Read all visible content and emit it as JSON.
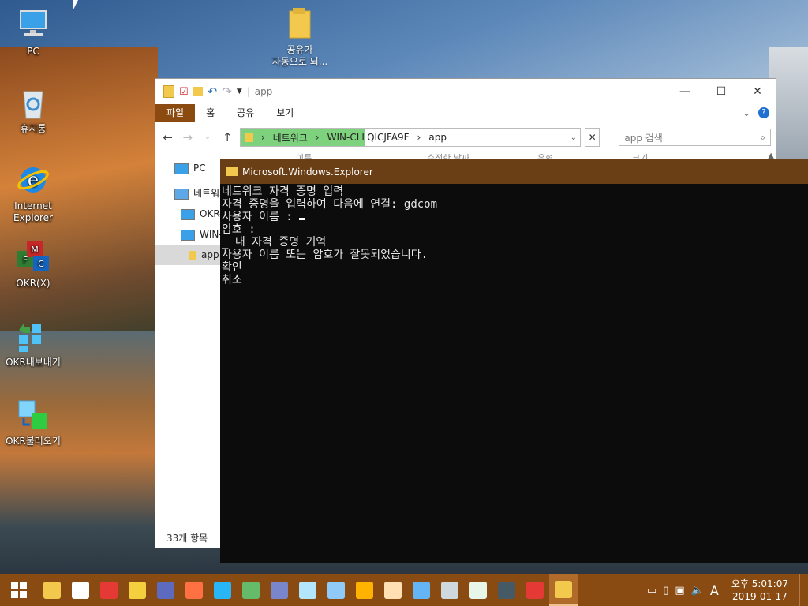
{
  "desktop": {
    "icons": [
      {
        "label": "PC",
        "icon": "pc-icon"
      },
      {
        "label": "휴지통",
        "icon": "recycle-bin-icon"
      },
      {
        "label": "Internet Explorer",
        "icon": "internet-explorer-icon"
      },
      {
        "label": "OKR(X)",
        "icon": "okr-icon"
      },
      {
        "label": "OKR내보내기",
        "icon": "okr-export-icon"
      },
      {
        "label": "OKR불러오기",
        "icon": "okr-import-icon"
      }
    ],
    "folder": {
      "label_line1": "공유가",
      "label_line2": "자동으로 되..."
    }
  },
  "explorer": {
    "title": "app",
    "ribbon_tabs": [
      "파일",
      "홈",
      "공유",
      "보기"
    ],
    "breadcrumb": [
      "네트워크",
      "WIN-CLLQICJFA9F",
      "app"
    ],
    "search_placeholder": "app 검색",
    "columns": [
      "이름",
      "수정한 날짜",
      "유형",
      "크기"
    ],
    "nav": [
      {
        "label": "PC"
      },
      {
        "label": "네트워크"
      },
      {
        "label": "OKR-"
      },
      {
        "label": "WIN-"
      },
      {
        "label": "app"
      }
    ],
    "status": "33개 항목"
  },
  "console": {
    "title": "Microsoft.Windows.Explorer",
    "lines": [
      "네트워크 자격 증명 입력",
      "자격 증명을 입력하여 다음에 연결: gdcom",
      "사용자 이름 : ",
      "암호 :",
      "_ 내 자격 증명 기억",
      "사용자 이름 또는 암호가 잘못되었습니다.",
      "확인",
      "취소"
    ]
  },
  "taskbar": {
    "apps": [
      "file-explorer-icon",
      "capture-icon",
      "anydesk-icon",
      "player-icon",
      "browser-icon",
      "ccleaner-icon",
      "butterfly-icon",
      "globe-icon",
      "remote-icon",
      "document-icon",
      "network-icon",
      "cleaner-icon",
      "archive-icon",
      "laptop-icon",
      "tools-icon",
      "terminal-icon",
      "screenshot-icon",
      "close-app-icon",
      "folder-app-icon"
    ],
    "tray_ime": "A",
    "clock_time": "오후 5:01:07",
    "clock_date": "2019-01-17"
  },
  "colors": {
    "taskbar": "#8a4b12",
    "console_title": "#6b3f15",
    "ribbon_file": "#8b4a10",
    "address_highlight": "#7ed27e"
  }
}
